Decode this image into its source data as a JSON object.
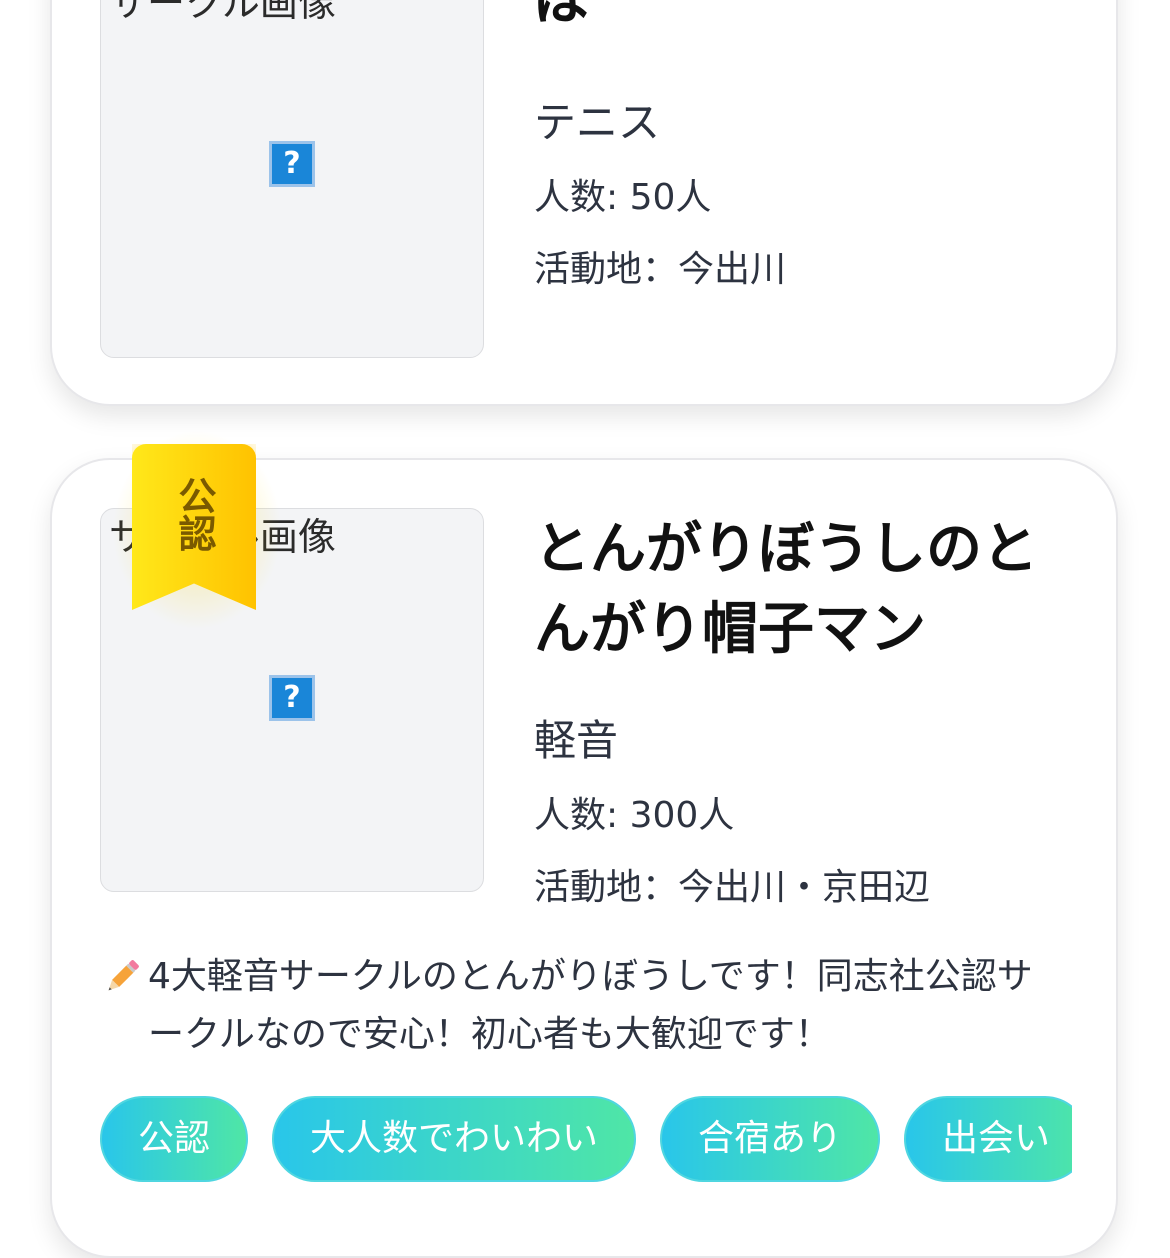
{
  "cards": [
    {
      "image_alt": "サークル画像",
      "title": "ぱ",
      "genre": "テニス",
      "members": "人数: 50人",
      "location": "活動地：今出川"
    },
    {
      "image_alt": "サークル画像",
      "badge": "公認",
      "title": "とんがりぼうしのとんがり帽子マン",
      "genre": "軽音",
      "members": "人数: 300人",
      "location": "活動地：今出川・京田辺",
      "description": "4大軽音サークルのとんがりぼうしです！同志社公認サークルなので安心！初心者も大歓迎です！",
      "description_icon": "pencil-icon",
      "tags": [
        "公認",
        "大人数でわいわい",
        "合宿あり",
        "出会い"
      ]
    }
  ],
  "colors": {
    "badge": "#ffd200",
    "tag_gradient_start": "#29c6ea",
    "tag_gradient_end": "#4fe6a6",
    "broken_image_icon": "#1a86d8"
  }
}
